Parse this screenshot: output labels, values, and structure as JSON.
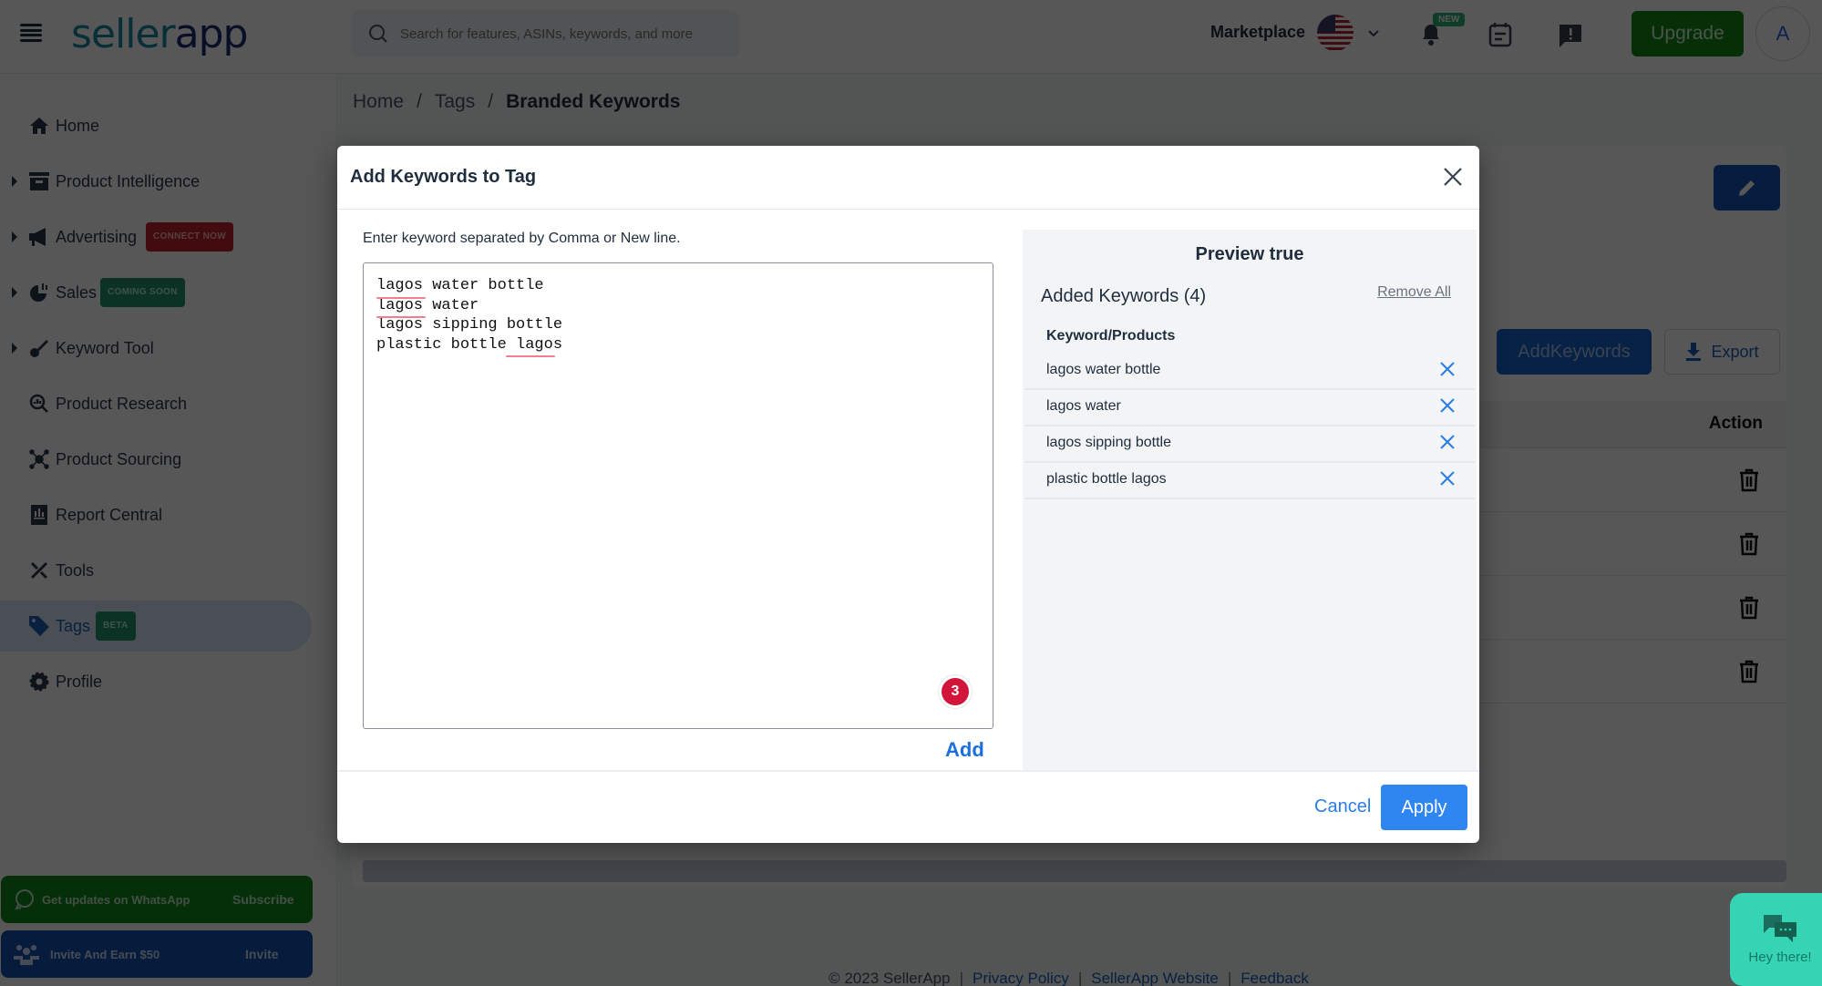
{
  "header": {
    "logo_part1": "seller",
    "logo_part2": "app",
    "search_placeholder": "Search for features, ASINs, keywords, and more",
    "marketplace_label": "Marketplace",
    "marketplace_flag": "us-flag-icon",
    "notification_badge": "NEW",
    "upgrade_label": "Upgrade",
    "avatar_initial": "A"
  },
  "sidebar": {
    "items": [
      {
        "label": "Home",
        "icon": "home-icon",
        "expandable": false
      },
      {
        "label": "Product Intelligence",
        "icon": "archive-icon",
        "expandable": true
      },
      {
        "label": "Advertising",
        "icon": "megaphone-icon",
        "expandable": true,
        "badge": "CONNECT NOW"
      },
      {
        "label": "Sales",
        "icon": "chart-pie-icon",
        "expandable": true,
        "badge": "COMING SOON"
      },
      {
        "label": "Keyword Tool",
        "icon": "key-icon",
        "expandable": true
      },
      {
        "label": "Product Research",
        "icon": "search-chart-icon",
        "expandable": false
      },
      {
        "label": "Product Sourcing",
        "icon": "network-icon",
        "expandable": false
      },
      {
        "label": "Report Central",
        "icon": "report-icon",
        "expandable": false
      },
      {
        "label": "Tools",
        "icon": "tools-icon",
        "expandable": false
      },
      {
        "label": "Tags",
        "icon": "tag-icon",
        "expandable": false,
        "badge": "BETA",
        "active": true
      },
      {
        "label": "Profile",
        "icon": "gear-icon",
        "expandable": false
      }
    ],
    "whatsapp": {
      "text": "Get updates on WhatsApp",
      "action": "Subscribe"
    },
    "invite": {
      "text": "Invite And Earn $50",
      "action": "Invite"
    }
  },
  "breadcrumb": {
    "items": [
      "Home",
      "Tags",
      "Branded Keywords"
    ]
  },
  "page": {
    "add_keywords_label": "AddKeywords",
    "export_label": "Export",
    "table_action_header": "Action",
    "row_count": 4
  },
  "footer": {
    "copyright": "© 2023 SellerApp",
    "links": [
      "Privacy Policy",
      "SellerApp Website",
      "Feedback"
    ]
  },
  "chat": {
    "label": "Hey there!"
  },
  "modal": {
    "title": "Add Keywords to Tag",
    "instructions": "Enter keyword separated by Comma or New line.",
    "textarea_value": "lagos water bottle\nlagos water\nlagos sipping bottle\nplastic bottle lagos",
    "grammar_issue_count": "3",
    "add_label": "Add",
    "preview": {
      "title": "Preview true",
      "added_label": "Added Keywords (4)",
      "remove_all_label": "Remove All",
      "column_header": "Keyword/Products",
      "keywords": [
        "lagos water bottle",
        "lagos water",
        "lagos sipping bottle",
        "plastic bottle lagos"
      ]
    },
    "cancel_label": "Cancel",
    "apply_label": "Apply"
  },
  "colors": {
    "primary_blue": "#2f86f0",
    "upgrade_green": "#128a1a",
    "badge_red": "#c0242c",
    "badge_green": "#21946a",
    "chat_teal": "#36d3b4"
  }
}
